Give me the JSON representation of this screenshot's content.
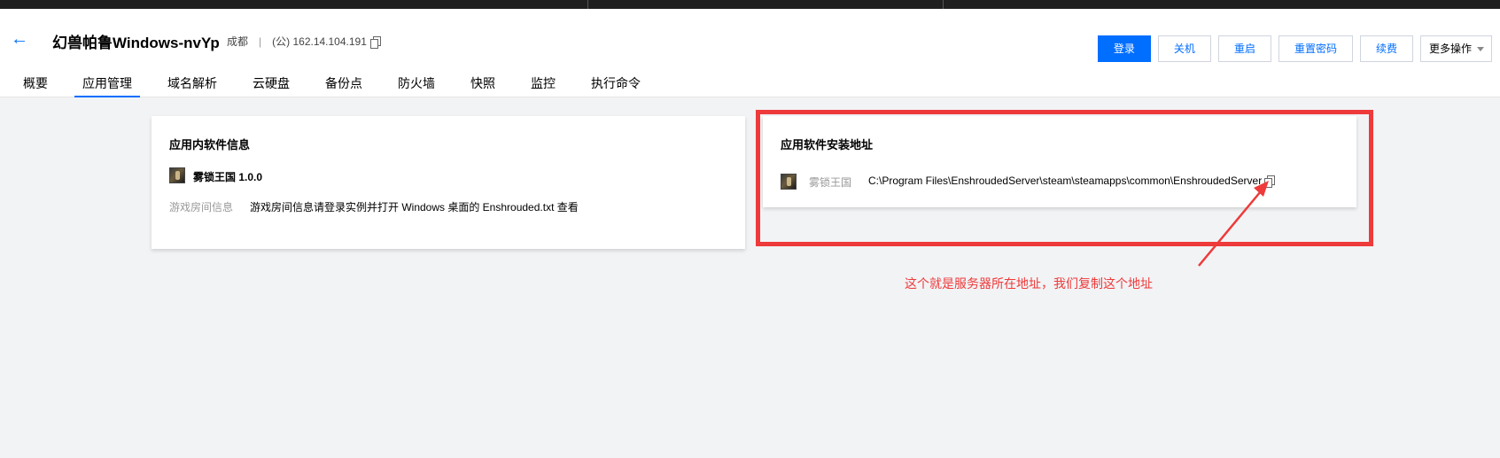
{
  "header": {
    "title": "幻兽帕鲁Windows-nvYp",
    "region": "成都",
    "separator": "|",
    "ip": "(公) 162.14.104.191"
  },
  "actions": {
    "login": "登录",
    "shutdown": "关机",
    "restart": "重启",
    "reset_password": "重置密码",
    "renew": "续费",
    "more": "更多操作"
  },
  "tabs": [
    {
      "label": "概要"
    },
    {
      "label": "应用管理"
    },
    {
      "label": "域名解析"
    },
    {
      "label": "云硬盘"
    },
    {
      "label": "备份点"
    },
    {
      "label": "防火墙"
    },
    {
      "label": "快照"
    },
    {
      "label": "监控"
    },
    {
      "label": "执行命令"
    }
  ],
  "active_tab": "应用管理",
  "software_info": {
    "title": "应用内软件信息",
    "app_name": "雾锁王国 1.0.0",
    "room_label": "游戏房间信息",
    "room_value": "游戏房间信息请登录实例并打开 Windows 桌面的 Enshrouded.txt 查看"
  },
  "install_path": {
    "title": "应用软件安装地址",
    "app_label": "雾锁王国",
    "path": "C:\\Program Files\\EnshroudedServer\\steam\\steamapps\\common\\EnshroudedServer"
  },
  "annotation": {
    "text": "这个就是服务器所在地址，我们复制这个地址",
    "color": "#ee3a3a"
  },
  "colors": {
    "accent": "#006eff",
    "background": "#f2f3f5",
    "highlight": "#ee3a3a"
  }
}
